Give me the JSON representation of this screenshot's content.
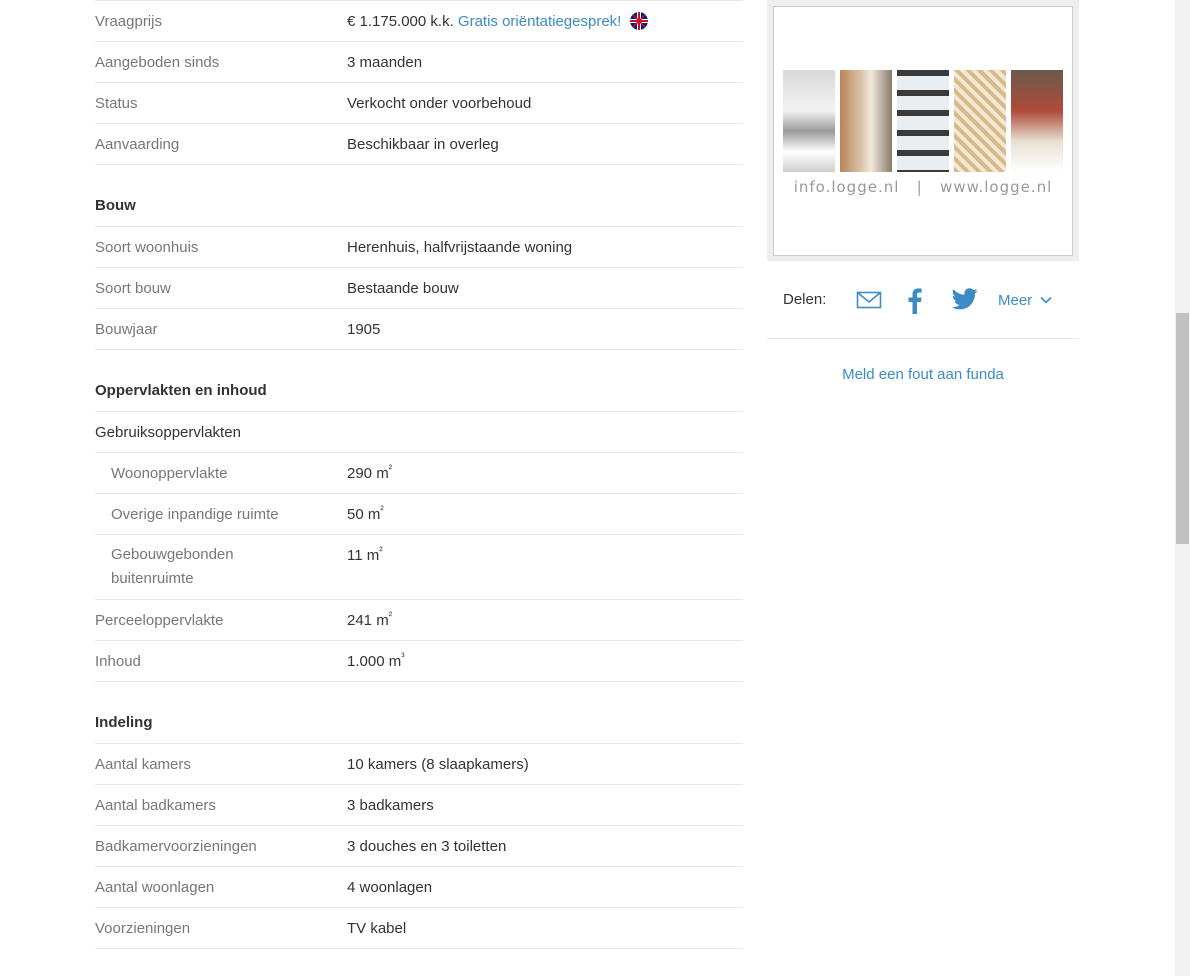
{
  "price": {
    "label": "Vraagprijs",
    "value": "€ 1.175.000 k.k.",
    "link": "Gratis oriëntatiegesprek!"
  },
  "transfer_rows": [
    {
      "label": "Aangeboden sinds",
      "value": "3 maanden"
    },
    {
      "label": "Status",
      "value": "Verkocht onder voorbehoud"
    },
    {
      "label": "Aanvaarding",
      "value": "Beschikbaar in overleg"
    }
  ],
  "bouw": {
    "title": "Bouw",
    "rows": [
      {
        "label": "Soort woonhuis",
        "value": "Herenhuis, halfvrijstaande woning"
      },
      {
        "label": "Soort bouw",
        "value": "Bestaande bouw"
      },
      {
        "label": "Bouwjaar",
        "value": "1905"
      }
    ]
  },
  "oppervlakten": {
    "title": "Oppervlakten en inhoud",
    "group_label": "Gebruiksoppervlakten",
    "woon": {
      "label": "Woonoppervlakte",
      "value": "290 m",
      "unit_sup": "²"
    },
    "overig": {
      "label": "Overige inpandige ruimte",
      "value": "50 m",
      "unit_sup": "²"
    },
    "buiten": {
      "label_line1": "Gebouwgebonden",
      "label_line2": "buitenruimte",
      "value": "11 m",
      "unit_sup": "²"
    },
    "perceel": {
      "label": "Perceeloppervlakte",
      "value": "241 m",
      "unit_sup": "²"
    },
    "inhoud": {
      "label": "Inhoud",
      "value": "1.000 m",
      "unit_sup": "³"
    }
  },
  "indeling": {
    "title": "Indeling",
    "rows": [
      {
        "label": "Aantal kamers",
        "value": "10 kamers (8 slaapkamers)"
      },
      {
        "label": "Aantal badkamers",
        "value": "3 badkamers"
      },
      {
        "label": "Badkamervoorzieningen",
        "value": "3 douches en 3 toiletten"
      },
      {
        "label": "Aantal woonlagen",
        "value": "4 woonlagen"
      },
      {
        "label": "Voorzieningen",
        "value": "TV kabel"
      }
    ]
  },
  "ad": {
    "text": "info.logge.nl   |   www.logge.nl"
  },
  "share": {
    "label": "Delen:",
    "more": "Meer",
    "icons": [
      "mail-icon",
      "facebook-icon",
      "twitter-icon",
      "chevron-down-icon"
    ]
  },
  "report_link": "Meld een fout aan funda",
  "colors": {
    "link": "#3c8bc4",
    "label": "#777777",
    "text": "#333333",
    "border": "#e6e6e6"
  }
}
